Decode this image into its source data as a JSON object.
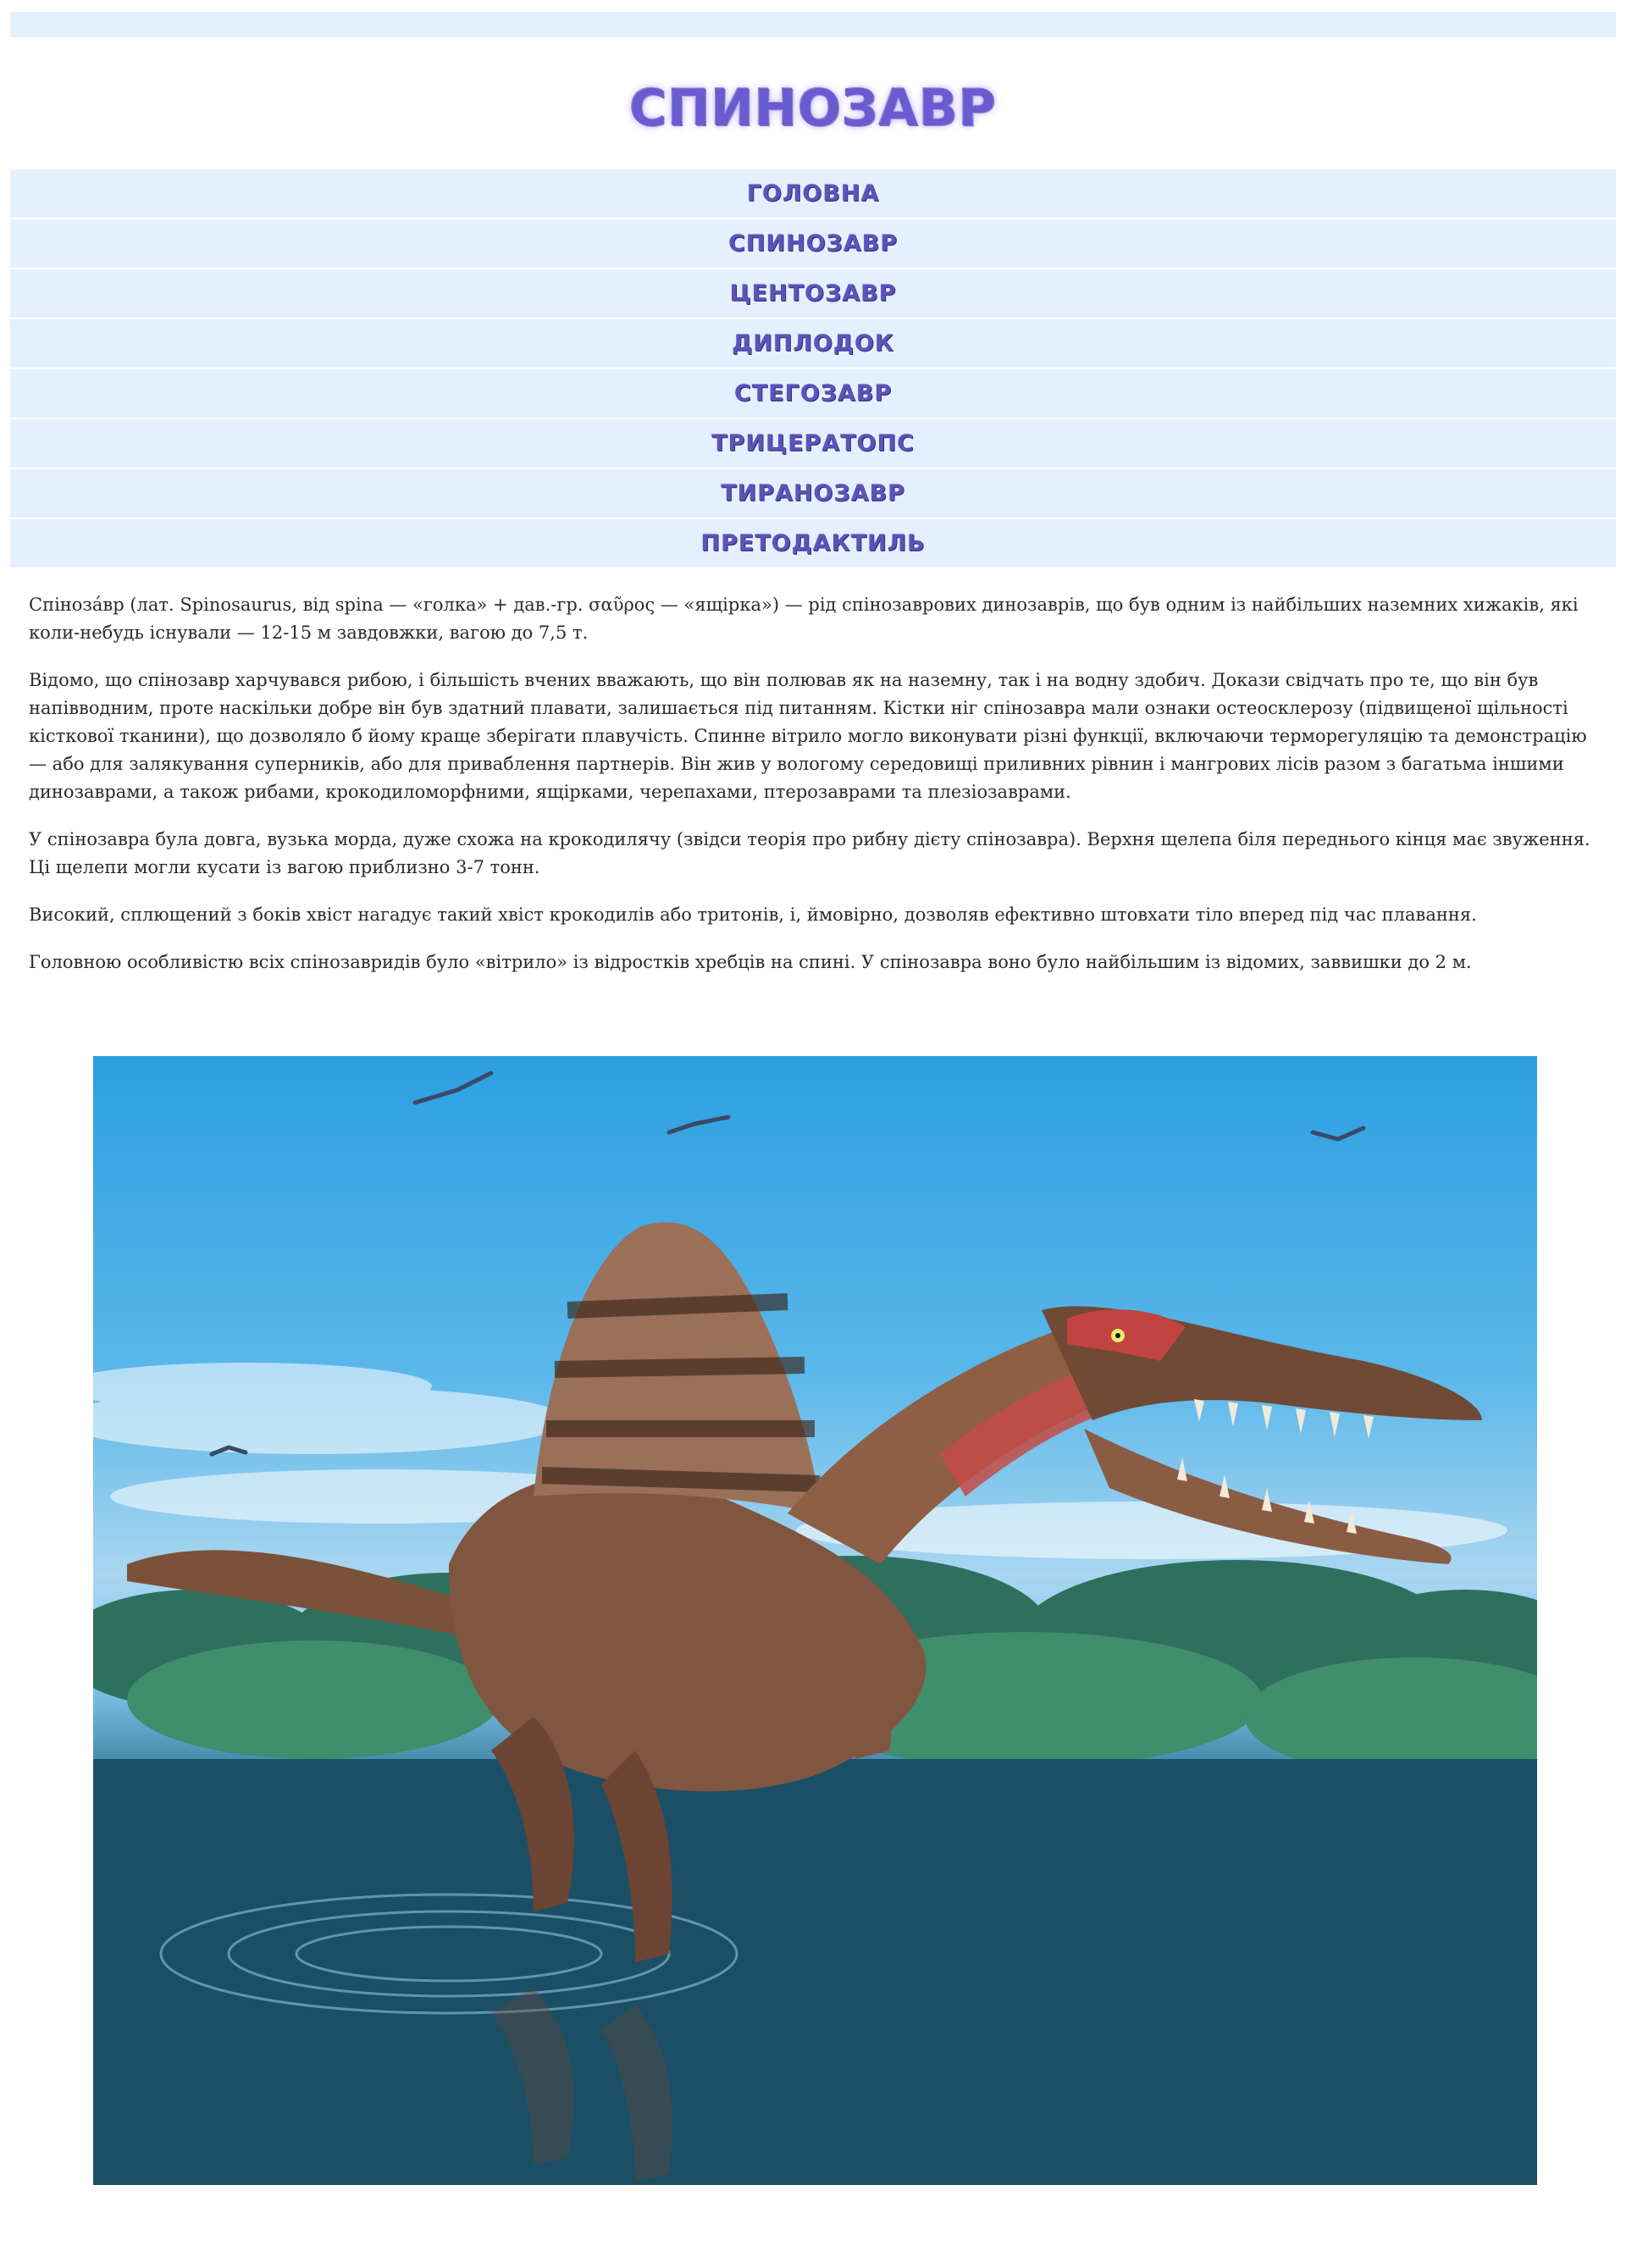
{
  "page": {
    "title": "СПИНОЗАВР"
  },
  "nav": {
    "items": [
      {
        "label": "ГОЛОВНА"
      },
      {
        "label": "СПИНОЗАВР"
      },
      {
        "label": "ЦЕНТОЗАВР"
      },
      {
        "label": "ДИПЛОДОК"
      },
      {
        "label": "СТЕГОЗАВР"
      },
      {
        "label": "ТРИЦЕРАТОПС"
      },
      {
        "label": "ТИРАНОЗАВР"
      },
      {
        "label": "ПРЕТОДАКТИЛЬ"
      }
    ]
  },
  "content": {
    "paragraphs": [
      "Спіноза́вр (лат. Spinosaurus, від spina — «голка» + дав.-гр. σαῦρος — «ящірка») — рід спінозаврових динозаврів, що був одним із найбільших наземних хижаків, які коли-небудь існували — 12-15 м завдовжки, вагою до 7,5 т.",
      "Відомо, що спінозавр харчувався рибою, і більшість вчених вважають, що він полював як на наземну, так і на водну здобич. Докази свідчать про те, що він був напівводним, проте наскільки добре він був здатний плавати, залишається під питанням. Кістки ніг спінозавра мали ознаки остеосклерозу (підвищеної щільності кісткової тканини), що дозволяло б йому краще зберігати плавучість. Спинне вітрило могло виконувати різні функції, включаючи терморегуляцію та демонстрацію — або для залякування суперників, або для приваблення партнерів. Він жив у вологому середовищі приливних рівнин і мангрових лісів разом з багатьма іншими динозаврами, а також рибами, крокодиломорфними, ящірками, черепахами, птерозаврами та плезіозаврами.",
      "У спінозавра була довга, вузька морда, дуже схожа на крокодилячу (звідси теорія про рибну дієту спінозавра). Верхня щелепа біля переднього кінця має звуження. Ці щелепи могли кусати із вагою приблизно 3-7 тонн.",
      "Високий, сплющений з боків хвіст нагадує такий хвіст крокодилів або тритонів, і, ймовірно, дозволяв ефективно штовхати тіло вперед під час плавання.",
      "Головною особливістю всіх спінозавридів було «вітрило» із відростків хребців на спині. У спінозавра воно було найбільшим із відомих, заввишки до 2 м."
    ]
  },
  "image": {
    "subject": "spinosaurus-illustration"
  }
}
